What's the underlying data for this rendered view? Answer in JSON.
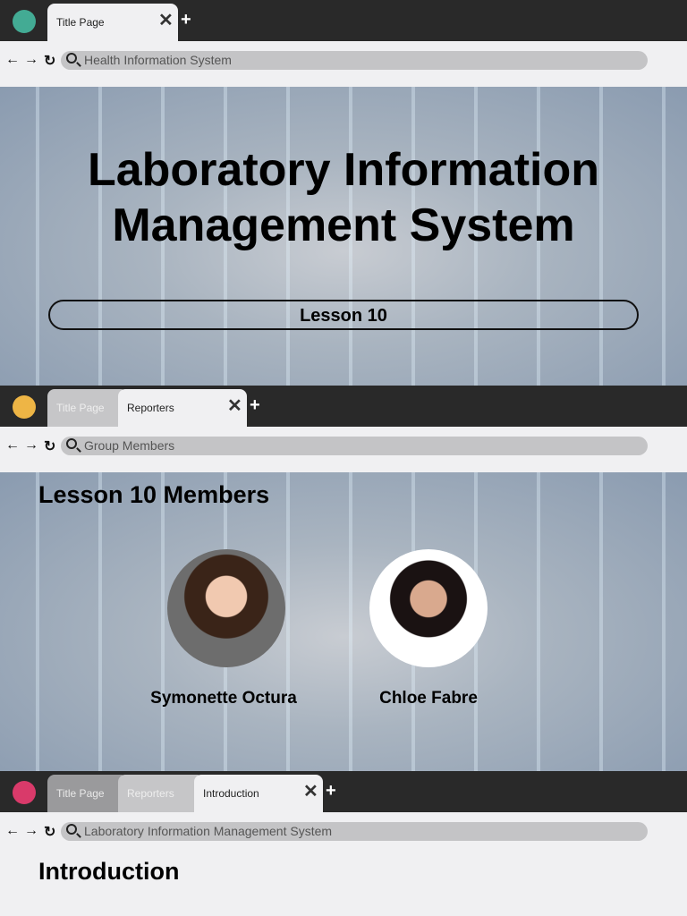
{
  "slides": [
    {
      "accent": "#43ab94",
      "tabs": [
        "Title Page"
      ],
      "url": "Health Information System",
      "title_line1": "Laboratory Information",
      "title_line2": "Management System",
      "lesson": "Lesson 10"
    },
    {
      "accent": "#eeb545",
      "tabs": [
        "Title Page",
        "Reporters"
      ],
      "url": "Group Members",
      "heading": "Lesson 10 Members",
      "members": [
        "Symonette Octura",
        "Chloe Fabre"
      ]
    },
    {
      "accent": "#d93a6a",
      "tabs": [
        "Title Page",
        "Reporters",
        "Introduction"
      ],
      "url": "Laboratory Information Management System",
      "heading": "Introduction"
    }
  ],
  "icons": {
    "back": "←",
    "forward": "→",
    "reload": "↻",
    "close": "✕",
    "new_tab": "+"
  }
}
